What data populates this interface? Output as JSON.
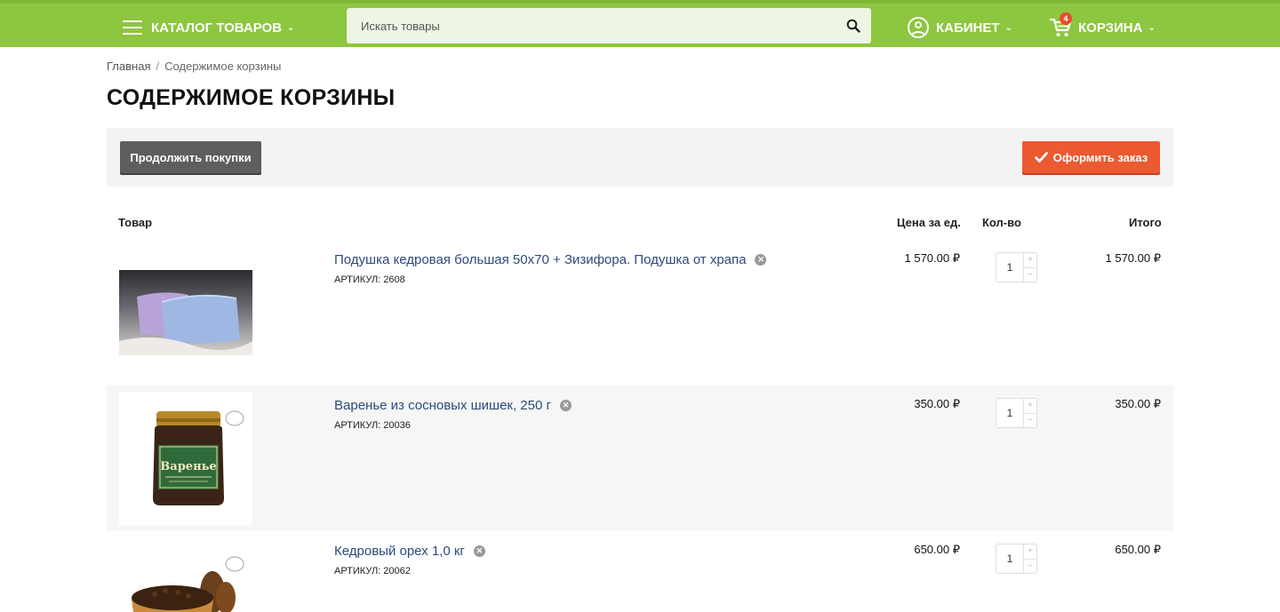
{
  "header": {
    "catalog_label": "КАТАЛОГ ТОВАРОВ",
    "search_placeholder": "Искать товары",
    "cabinet_label": "КАБИНЕТ",
    "cart_label": "КОРЗИНА",
    "cart_count": "4"
  },
  "breadcrumb": {
    "home": "Главная",
    "separator": "/",
    "current": "Содержимое корзины"
  },
  "page_title": "СОДЕРЖИМОЕ КОРЗИНЫ",
  "actions": {
    "continue_label": "Продолжить покупки",
    "order_label": "Оформить заказ"
  },
  "table": {
    "headers": {
      "product": "Товар",
      "unit_price": "Цена за ед.",
      "qty": "Кол-во",
      "total": "Итого"
    },
    "rows": [
      {
        "name": "Подушка кедровая большая 50x70 + Зизифора. Подушка от храпа",
        "sku": "АРТИКУЛ: 2608",
        "price": "1 570.00 ₽",
        "qty": "1",
        "total": "1 570.00 ₽",
        "image": "pillows"
      },
      {
        "name": "Варенье из сосновых шишек, 250 г",
        "sku": "АРТИКУЛ: 20036",
        "price": "350.00 ₽",
        "qty": "1",
        "total": "350.00 ₽",
        "image": "jam-jar",
        "jar_label": "Варенье"
      },
      {
        "name": "Кедровый орех 1,0 кг",
        "sku": "АРТИКУЛ: 20062",
        "price": "650.00 ₽",
        "qty": "1",
        "total": "650.00 ₽",
        "image": "cedar-nuts"
      }
    ]
  },
  "colors": {
    "header_green": "#8dc63f",
    "order_orange": "#eb5a30",
    "continue_gray": "#5e5e5e",
    "link_blue": "#2d4a7c"
  },
  "icons": [
    "menu-icon",
    "chevron-down-icon",
    "search-icon",
    "user-icon",
    "cart-icon",
    "remove-icon",
    "check-icon",
    "plus-icon",
    "minus-icon"
  ]
}
